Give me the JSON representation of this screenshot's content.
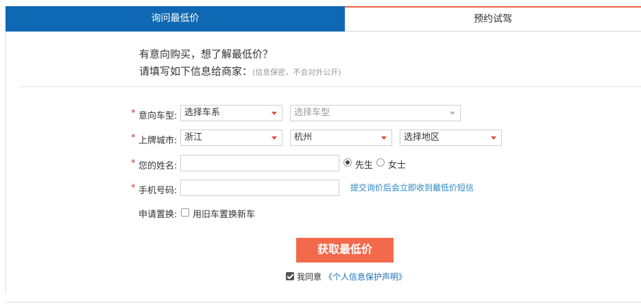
{
  "tabs": [
    {
      "label": "询问最低价",
      "active": true
    },
    {
      "label": "预约试驾",
      "active": false
    }
  ],
  "intro": {
    "line1": "有意向购买，想了解最低价？",
    "line2": "请填写如下信息给商家：",
    "note": "(信息保密，不会对外公开)"
  },
  "form": {
    "required_mark": "*",
    "car_model": {
      "label": "意向车型:",
      "series_value": "选择车系",
      "model_value": "选择车型"
    },
    "city": {
      "label": "上牌城市:",
      "province_value": "浙江",
      "city_value": "杭州",
      "district_value": "选择地区"
    },
    "name": {
      "label": "您的姓名:",
      "value": "",
      "gender_male": "先生",
      "gender_female": "女士",
      "selected": "male"
    },
    "phone": {
      "label": "手机号码:",
      "value": "",
      "hint": "提交询价后会立即收到最低价短信"
    },
    "trade_in": {
      "label": "申请置换:",
      "option": "用旧车置换新车",
      "checked": false
    },
    "submit_label": "获取最低价",
    "agree": {
      "text": "我同意",
      "link": "《个人信息保护声明》",
      "checked": true
    }
  },
  "colors": {
    "tab_active": "#0f68b3",
    "accent": "#f26a4b",
    "link": "#2a87c7"
  }
}
